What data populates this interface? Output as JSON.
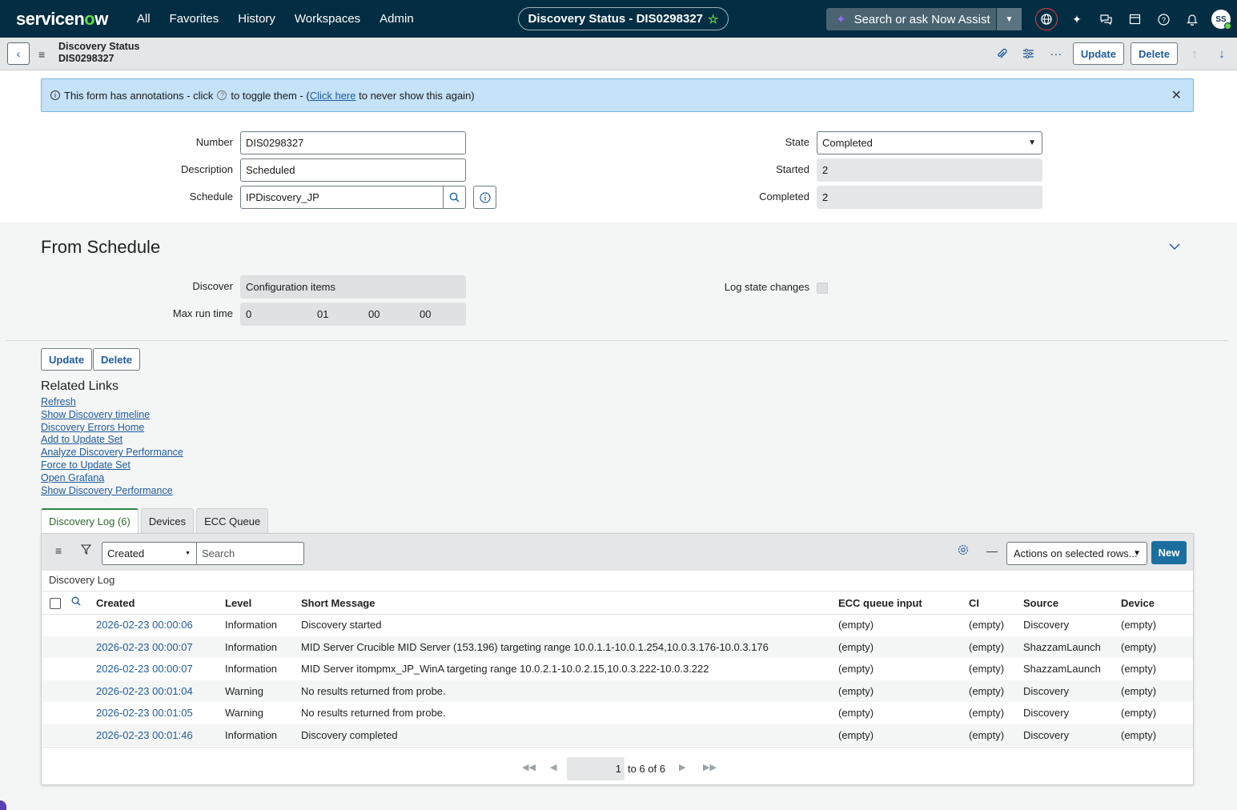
{
  "topnav": {
    "logo": "servicenow",
    "links": [
      "All",
      "Favorites",
      "History",
      "Workspaces",
      "Admin"
    ],
    "record_title": "Discovery Status - DIS0298327",
    "assist_placeholder": "Search or ask Now Assist",
    "avatar_initials": "SS"
  },
  "header": {
    "title_line1": "Discovery Status",
    "title_line2": "DIS0298327",
    "update_label": "Update",
    "delete_label": "Delete"
  },
  "annotation": {
    "text_before": "This form has annotations - click",
    "text_middle": "to toggle them - (",
    "link": "Click here",
    "text_after": "to never show this again)"
  },
  "form": {
    "number_label": "Number",
    "number_value": "DIS0298327",
    "description_label": "Description",
    "description_value": "Scheduled",
    "schedule_label": "Schedule",
    "schedule_value": "IPDiscovery_JP",
    "state_label": "State",
    "state_value": "Completed",
    "started_label": "Started",
    "started_value": "2",
    "completed_label": "Completed",
    "completed_value": "2"
  },
  "from_schedule": {
    "title": "From Schedule",
    "discover_label": "Discover",
    "discover_value": "Configuration items",
    "max_run_label": "Max run time",
    "max_run_days": "0",
    "max_run_hours": "01",
    "max_run_minutes": "00",
    "max_run_seconds": "00",
    "log_state_label": "Log state changes"
  },
  "bottom_buttons": {
    "update": "Update",
    "delete": "Delete"
  },
  "related_links": {
    "title": "Related Links",
    "links": [
      "Refresh",
      "Show Discovery timeline",
      "Discovery Errors Home",
      "Add to Update Set",
      "Analyze Discovery Performance",
      "Force to Update Set",
      "Open Grafana",
      "Show Discovery Performance"
    ]
  },
  "tabs": [
    "Discovery Log (6)",
    "Devices",
    "ECC Queue"
  ],
  "list": {
    "search_field": "Created",
    "search_placeholder": "Search",
    "actions_label": "Actions on selected rows...",
    "new_label": "New",
    "caption": "Discovery Log",
    "columns": [
      "Created",
      "Level",
      "Short Message",
      "ECC queue input",
      "CI",
      "Source",
      "Device"
    ],
    "rows": [
      [
        "2026-02-23 00:00:06",
        "Information",
        "Discovery started",
        "(empty)",
        "(empty)",
        "Discovery",
        "(empty)"
      ],
      [
        "2026-02-23 00:00:07",
        "Information",
        "MID Server Crucible MID Server (153.196) targeting range 10.0.1.1-10.0.1.254,10.0.3.176-10.0.3.176",
        "(empty)",
        "(empty)",
        "ShazzamLaunch",
        "(empty)"
      ],
      [
        "2026-02-23 00:00:07",
        "Information",
        "MID Server itompmx_JP_WinA targeting range 10.0.2.1-10.0.2.15,10.0.3.222-10.0.3.222",
        "(empty)",
        "(empty)",
        "ShazzamLaunch",
        "(empty)"
      ],
      [
        "2026-02-23 00:01:04",
        "Warning",
        "No results returned from probe.",
        "(empty)",
        "(empty)",
        "Discovery",
        "(empty)"
      ],
      [
        "2026-02-23 00:01:05",
        "Warning",
        "No results returned from probe.",
        "(empty)",
        "(empty)",
        "Discovery",
        "(empty)"
      ],
      [
        "2026-02-23 00:01:46",
        "Information",
        "Discovery completed",
        "(empty)",
        "(empty)",
        "Discovery",
        "(empty)"
      ]
    ],
    "pager_page": "1",
    "pager_text": "to 6 of 6"
  }
}
